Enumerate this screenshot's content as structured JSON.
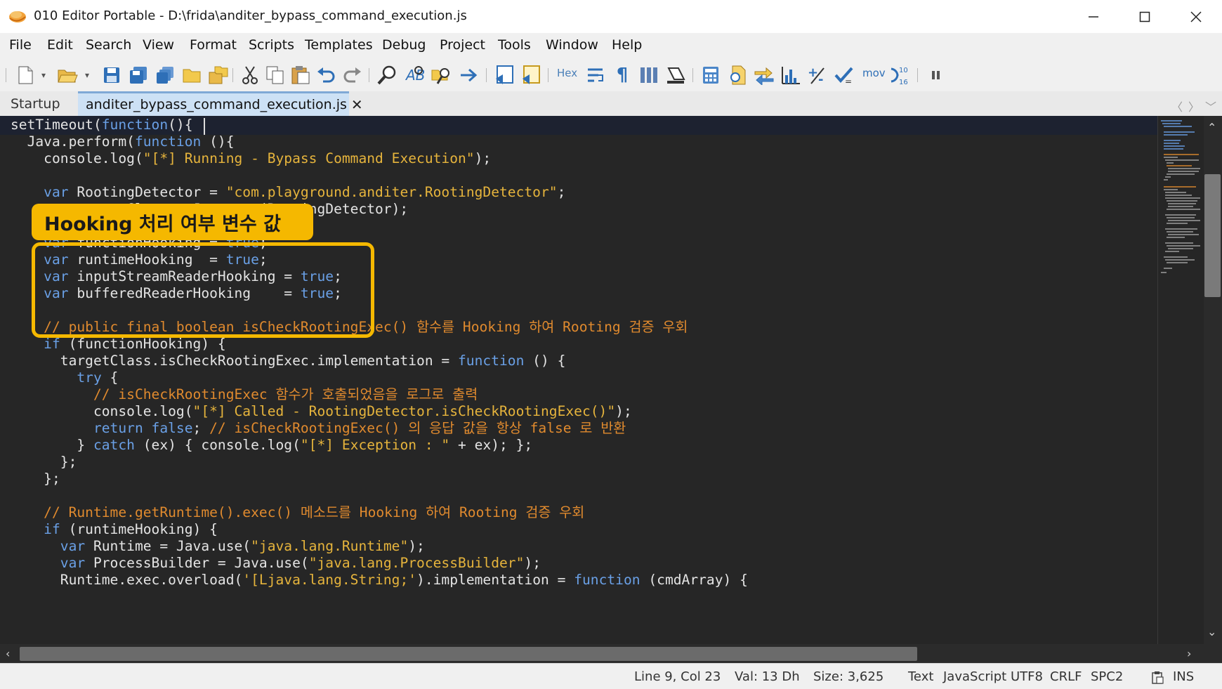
{
  "window": {
    "title": "010 Editor Portable - D:\\frida\\anditer_bypass_command_execution.js",
    "controls": {
      "minimize": "—",
      "maximize": "☐",
      "close": "✕"
    }
  },
  "menu": [
    "File",
    "Edit",
    "Search",
    "View",
    "Format",
    "Scripts",
    "Templates",
    "Debug",
    "Project",
    "Tools",
    "Window",
    "Help"
  ],
  "toolbar": {
    "hex_label": "Hex",
    "mov_label": "mov",
    "icons": [
      "new-file-icon",
      "open-folder-icon",
      "save-icon",
      "save-as-icon",
      "save-all-icon",
      "folder-icon",
      "workspace-icon",
      "cut-icon",
      "copy-icon",
      "paste-icon",
      "undo-icon",
      "redo-icon",
      "find-icon",
      "replace-icon",
      "find-in-files-icon",
      "goto-icon",
      "run-script-icon",
      "run-template-icon",
      "hex-toggle-icon",
      "word-wrap-icon",
      "pilcrow-icon",
      "columns-icon",
      "highlight-icon",
      "calculator-icon",
      "inspector-icon",
      "compare-icon",
      "histogram-icon",
      "base-convert-icon",
      "checksum-icon",
      "disassemble-icon",
      "byte-order-icon",
      "pause-icon"
    ]
  },
  "tabs": {
    "startup": "Startup",
    "active": "anditer_bypass_command_execution.js",
    "close_glyph": "✕",
    "nav_left": "〈",
    "nav_right": "〉",
    "nav_menu": "﹀"
  },
  "code": [
    [
      [
        "p",
        "setTimeout("
      ],
      [
        "k",
        "function"
      ],
      [
        "p",
        "(){"
      ]
    ],
    [
      [
        "p",
        "  Java.perform("
      ],
      [
        "k",
        "function"
      ],
      [
        "p",
        " (){"
      ]
    ],
    [
      [
        "p",
        "    console.log("
      ],
      [
        "s",
        "\"[*] Running - Bypass Command Execution\""
      ],
      [
        "p",
        ");"
      ]
    ],
    [],
    [
      [
        "k",
        "    var"
      ],
      [
        "p",
        " RootingDetector = "
      ],
      [
        "s",
        "\"com.playground.anditer.RootingDetector\""
      ],
      [
        "p",
        ";"
      ]
    ],
    [
      [
        "k",
        "    var"
      ],
      [
        "p",
        " targetClass = Java.use(RootingDetector);"
      ]
    ],
    [],
    [
      [
        "k",
        "    var"
      ],
      [
        "p",
        " functionHooking = "
      ],
      [
        "k",
        "true"
      ],
      [
        "p",
        ";"
      ]
    ],
    [
      [
        "k",
        "    var"
      ],
      [
        "p",
        " runtimeHooking  = "
      ],
      [
        "k",
        "true"
      ],
      [
        "p",
        ";"
      ]
    ],
    [
      [
        "k",
        "    var"
      ],
      [
        "p",
        " inputStreamReaderHooking = "
      ],
      [
        "k",
        "true"
      ],
      [
        "p",
        ";"
      ]
    ],
    [
      [
        "k",
        "    var"
      ],
      [
        "p",
        " bufferedReaderHooking    = "
      ],
      [
        "k",
        "true"
      ],
      [
        "p",
        ";"
      ]
    ],
    [],
    [
      [
        "c",
        "    // public final boolean isCheckRootingExec() 함수를 Hooking 하여 Rooting 검증 우회"
      ]
    ],
    [
      [
        "k",
        "    if"
      ],
      [
        "p",
        " (functionHooking) {"
      ]
    ],
    [
      [
        "p",
        "      targetClass.isCheckRootingExec.implementation = "
      ],
      [
        "k",
        "function"
      ],
      [
        "p",
        " () {"
      ]
    ],
    [
      [
        "k",
        "        try"
      ],
      [
        "p",
        " {"
      ]
    ],
    [
      [
        "c",
        "          // isCheckRootingExec 함수가 호출되었음을 로그로 출력"
      ]
    ],
    [
      [
        "p",
        "          console.log("
      ],
      [
        "s",
        "\"[*] Called - RootingDetector.isCheckRootingExec()\""
      ],
      [
        "p",
        ");"
      ]
    ],
    [
      [
        "k",
        "          return false"
      ],
      [
        "p",
        "; "
      ],
      [
        "c",
        "// isCheckRootingExec() 의 응답 값을 항상 false 로 반환"
      ]
    ],
    [
      [
        "p",
        "        } "
      ],
      [
        "k",
        "catch"
      ],
      [
        "p",
        " (ex) { console.log("
      ],
      [
        "s",
        "\"[*] Exception : \""
      ],
      [
        "p",
        " + ex); };"
      ]
    ],
    [
      [
        "p",
        "      };"
      ]
    ],
    [
      [
        "p",
        "    };"
      ]
    ],
    [],
    [
      [
        "c",
        "    // Runtime.getRuntime().exec() 메소드를 Hooking 하여 Rooting 검증 우회"
      ]
    ],
    [
      [
        "k",
        "    if"
      ],
      [
        "p",
        " (runtimeHooking) {"
      ]
    ],
    [
      [
        "k",
        "      var"
      ],
      [
        "p",
        " Runtime = Java.use("
      ],
      [
        "s",
        "\"java.lang.Runtime\""
      ],
      [
        "p",
        ");"
      ]
    ],
    [
      [
        "k",
        "      var"
      ],
      [
        "p",
        " ProcessBuilder = Java.use("
      ],
      [
        "s",
        "\"java.lang.ProcessBuilder\""
      ],
      [
        "p",
        ");"
      ]
    ],
    [
      [
        "p",
        "      Runtime.exec.overload("
      ],
      [
        "s",
        "'[Ljava.lang.String;'"
      ],
      [
        "p",
        ").implementation = "
      ],
      [
        "k",
        "function"
      ],
      [
        "p",
        " (cmdArray) {"
      ]
    ]
  ],
  "annotation": {
    "label": "Hooking 처리 여부 변수 값"
  },
  "status": {
    "position": "Line 9, Col 23",
    "value": "Val: 13 Dh",
    "size": "Size: 3,625",
    "mode": "Text",
    "language": "JavaScript",
    "encoding": "UTF8",
    "line_ending": "CRLF",
    "indent": "SPC2",
    "insert_mode": "INS"
  },
  "colors": {
    "keyword": "#6aa0e6",
    "string": "#e6b43c",
    "comment": "#e08a2e",
    "annotation": "#f5b800"
  }
}
